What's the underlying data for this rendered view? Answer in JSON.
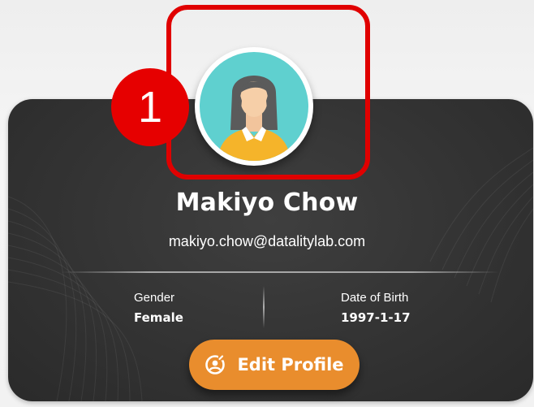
{
  "profile": {
    "name": "Makiyo Chow",
    "email": "makiyo.chow@datalitylab.com",
    "gender_label": "Gender",
    "gender_value": "Female",
    "dob_label": "Date of Birth",
    "dob_value": "1997-1-17"
  },
  "actions": {
    "edit_label": "Edit Profile",
    "edit_icon": "user-edit-icon"
  },
  "annotation": {
    "step_number": "1",
    "highlight_color": "#e00000"
  },
  "colors": {
    "card_background": "#333333",
    "button_accent": "#e98d2d",
    "avatar_background": "#5fd0cf",
    "avatar_shirt": "#f5b42a",
    "avatar_hair": "#5b5b5b"
  }
}
